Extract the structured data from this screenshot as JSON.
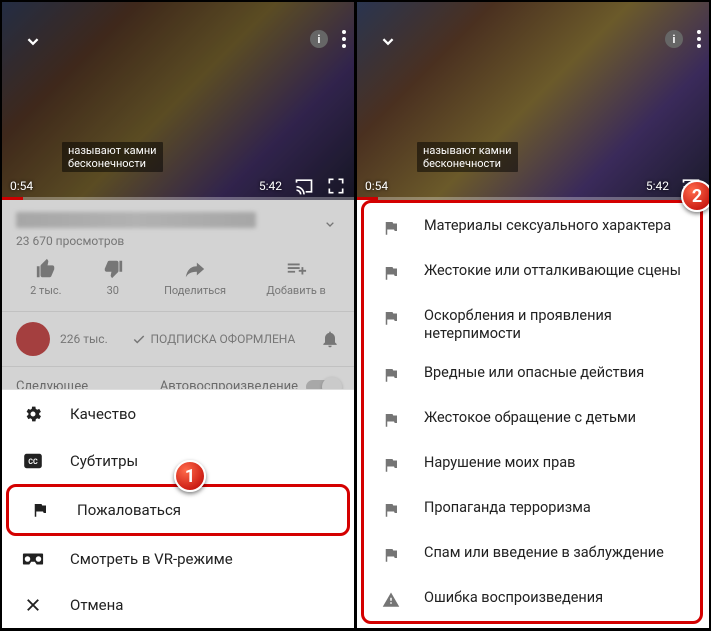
{
  "video": {
    "time_left": "0:54",
    "time_right_dim": "5:42",
    "time_right_clear": "5:42",
    "subtitle_l1": "называют камни",
    "subtitle_l2": "бесконечности"
  },
  "meta": {
    "views": "23 670 просмотров",
    "actions": {
      "like": "2 тыс.",
      "dislike": "30",
      "share": "Поделиться",
      "add": "Добавить в"
    },
    "channel_subs": "226 тыс.",
    "subscribed": "ПОДПИСКА ОФОРМЛЕНА",
    "up_next": "Следующее",
    "autoplay": "Автовоспроизведение"
  },
  "sheet": {
    "quality": "Качество",
    "captions": "Субтитры",
    "report": "Пожаловаться",
    "vr": "Смотреть в VR-режиме",
    "cancel": "Отмена"
  },
  "reasons": [
    "Материалы сексуального характера",
    "Жестокие или отталкивающие сцены",
    "Оскорбления и проявления нетерпимости",
    "Вредные или опасные действия",
    "Жестокое обращение с детьми",
    "Нарушение моих прав",
    "Пропаганда терроризма",
    "Спам или введение в заблуждение",
    "Ошибка воспроизведения"
  ],
  "callouts": {
    "one": "1",
    "two": "2"
  }
}
